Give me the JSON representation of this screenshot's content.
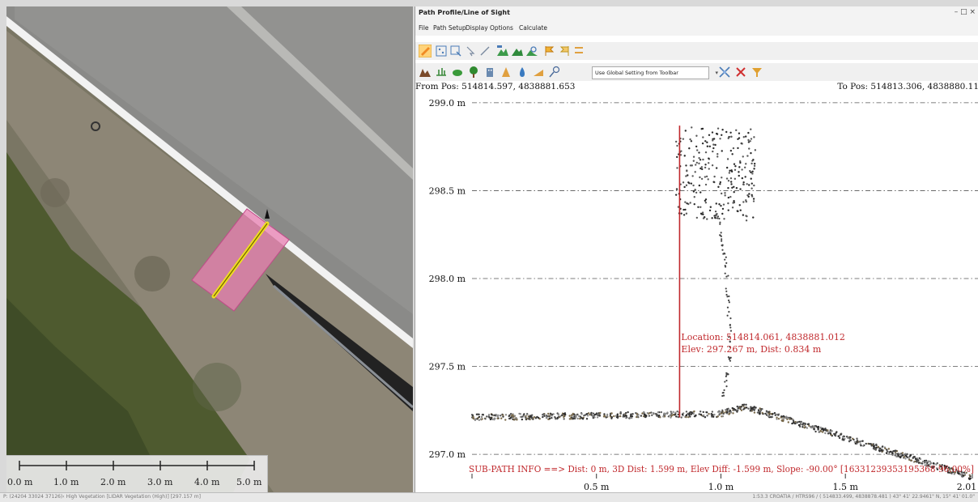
{
  "window": {
    "title": "Path Profile/Line of Sight",
    "controls": "– □ ×"
  },
  "menu": [
    {
      "label": "File"
    },
    {
      "label": "Path Setup"
    },
    {
      "label": "Display Options"
    },
    {
      "label": "Calculate"
    }
  ],
  "toolbar2": {
    "select_value": "Use Global Setting from Toolbar"
  },
  "profile": {
    "from_pos": "From Pos: 514814.597, 4838881.653",
    "to_pos": "To Pos: 514813.306, 4838880.11"
  },
  "chart_data": {
    "type": "scatter",
    "y_ticks": [
      "299.0 m",
      "298.5 m",
      "298.0 m",
      "297.5 m",
      "297.0 m"
    ],
    "y_tick_values": [
      299.0,
      298.5,
      298.0,
      297.5,
      297.0
    ],
    "x_ticks": [
      "0.5 m",
      "1.0 m",
      "1.5 m",
      "2.01 m"
    ],
    "x_tick_values": [
      0.5,
      1.0,
      1.5,
      2.01
    ],
    "xlim": [
      0,
      2.01
    ],
    "ylim": [
      296.83,
      299.05
    ],
    "grid": true,
    "cursor_x": 0.834,
    "cursor_y_top": 298.87,
    "cursor_y_bottom": 297.21,
    "series": [
      {
        "name": "ground",
        "segments": [
          [
            0.0,
            297.21
          ],
          [
            1.0,
            297.23
          ],
          [
            1.1,
            297.27
          ],
          [
            2.01,
            296.87
          ]
        ]
      },
      {
        "name": "trunk",
        "segments": [
          [
            1.0,
            297.23
          ],
          [
            1.04,
            297.6
          ],
          [
            1.02,
            298.1
          ],
          [
            0.98,
            298.4
          ]
        ]
      },
      {
        "name": "canopy",
        "x_range": [
          0.82,
          1.14
        ],
        "y_range": [
          298.33,
          298.86
        ]
      }
    ],
    "annotations": {
      "location": "Location: 514814.061, 4838881.012",
      "elev": "Elev: 297.267 m, Dist: 0.834 m",
      "subpath": "SUB-PATH INFO ==> Dist: 0 m, 3D Dist: 1.599 m, Elev Diff: -1.599 m, Slope: -90.00° [16331239353195368 96.00%]"
    }
  },
  "scalebar": {
    "labels": [
      "0.0 m",
      "1.0 m",
      "2.0 m",
      "3.0 m",
      "4.0 m",
      "5.0 m"
    ]
  },
  "status": {
    "left": "P: (24204 33024 37126)‹ High Vegetation [LIDAR Vegetation (High)] [297.157 m]",
    "right": "1:53.3 CROATIA / HTRS96 / ( 514833.499, 4838878.481 ) 43° 41' 22.9461\" N, 15° 41' 01.0\""
  },
  "colors": {
    "accent_red": "#c0282c",
    "selection_pink": "#e87fb2",
    "path_yellow": "#f0e020"
  }
}
